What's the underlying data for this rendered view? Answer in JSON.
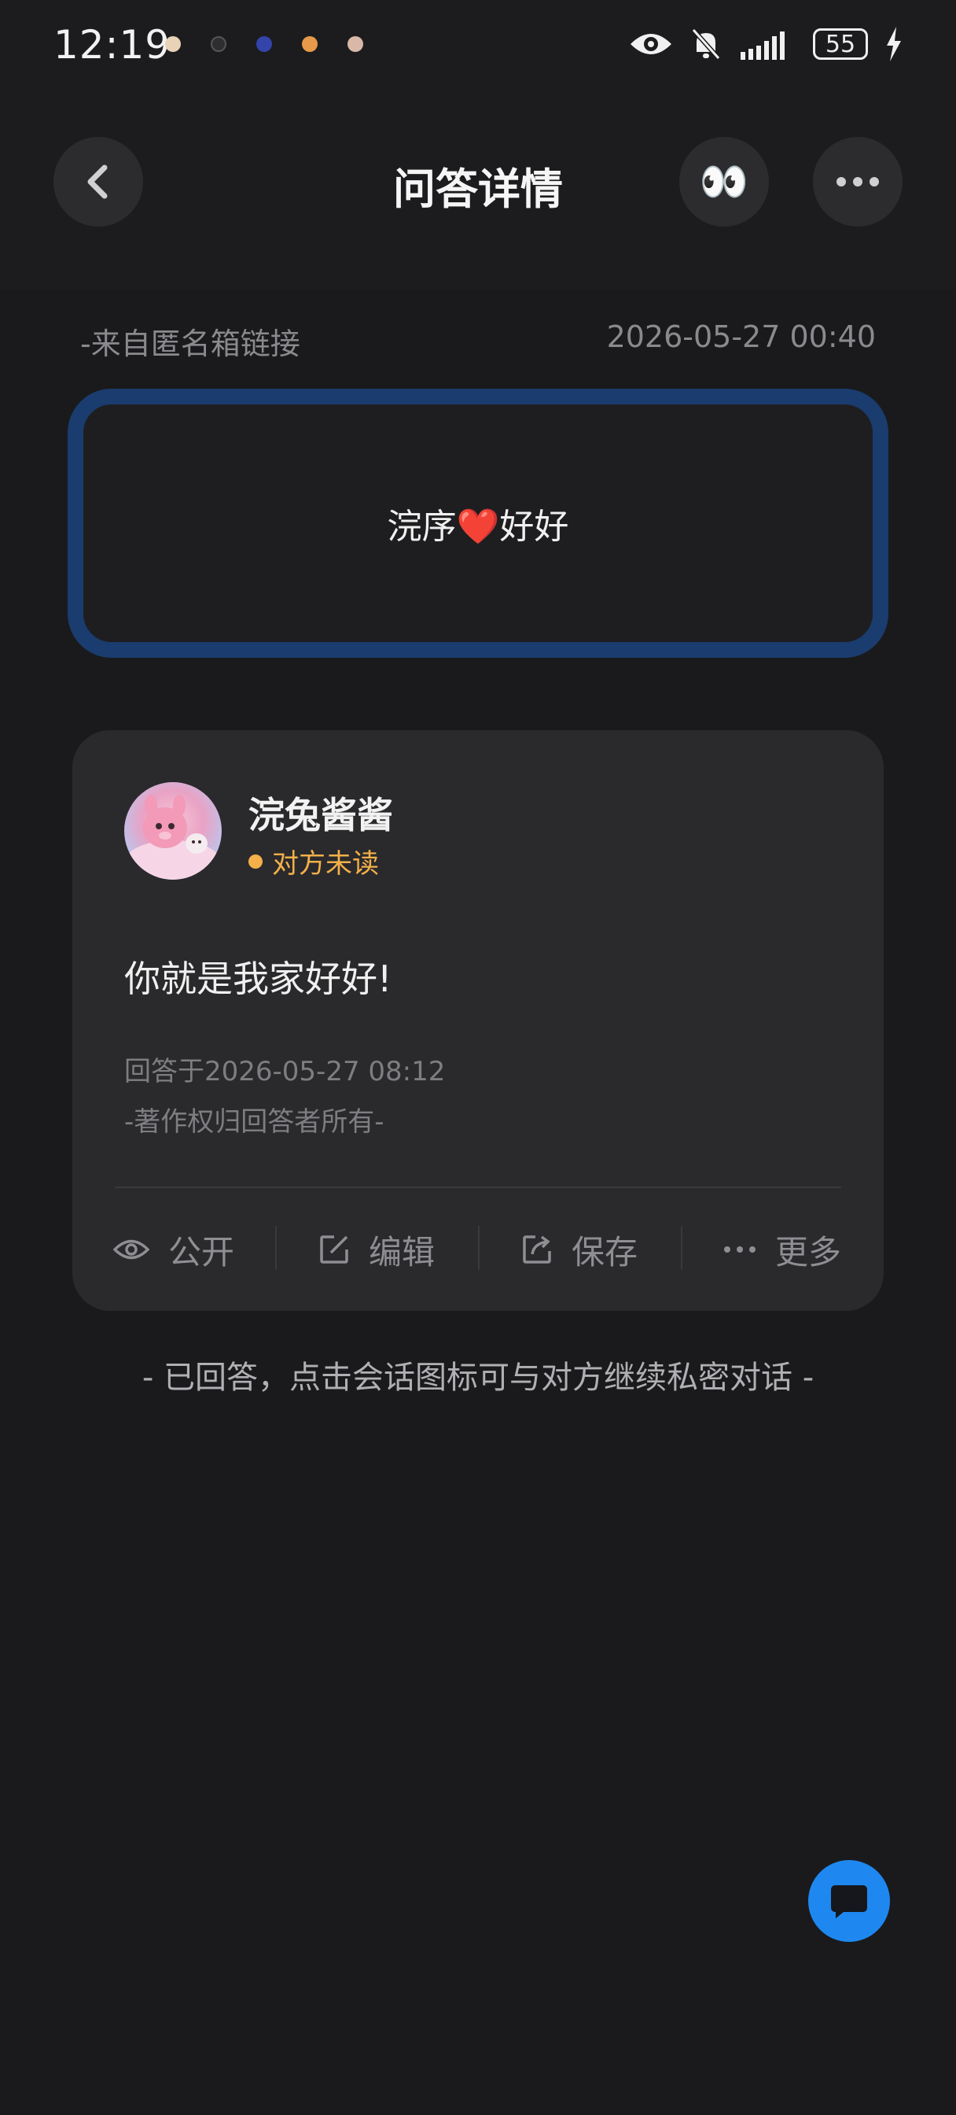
{
  "status_bar": {
    "time": "12:19",
    "battery": "55"
  },
  "header": {
    "title": "问答详情",
    "eyes_emoji": "👀"
  },
  "question": {
    "source": "-来自匿名箱链接",
    "time": "2026-05-27 00:40",
    "text_before": "浣序",
    "heart": "❤️",
    "text_after": "好好"
  },
  "answer": {
    "user_name": "浣兔酱酱",
    "read_status": "对方未读",
    "text": "你就是我家好好!",
    "answered_at": "回答于2026-05-27 08:12",
    "copyright": "-著作权归回答者所有-"
  },
  "actions": {
    "public_label": "公开",
    "edit_label": "编辑",
    "save_label": "保存",
    "more_label": "更多"
  },
  "footer_note": "- 已回答，点击会话图标可与对方继续私密对话 -",
  "colors": {
    "accent": "#1e88f0",
    "status_unread": "#f4b04a",
    "question_border": "#1a3c6e"
  }
}
